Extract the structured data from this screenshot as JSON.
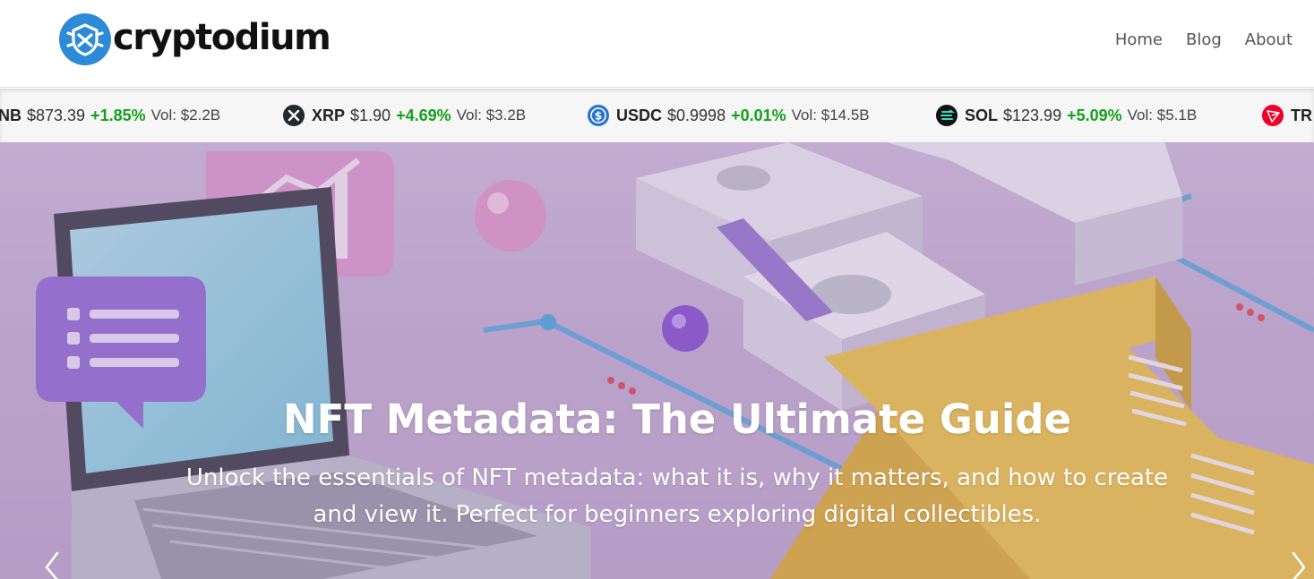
{
  "brand": {
    "name": "cryptodium",
    "logo_icon": "shield-coin-icon",
    "color": "#2d8ad6"
  },
  "nav": {
    "items": [
      {
        "label": "Home"
      },
      {
        "label": "Blog"
      },
      {
        "label": "About"
      }
    ]
  },
  "ticker": {
    "items": [
      {
        "symbol": "NB",
        "price": "$873.39",
        "change": "+1.85%",
        "volume": "Vol: $2.2B",
        "icon": "bnb-icon",
        "color": "#f3ba2f"
      },
      {
        "symbol": "XRP",
        "price": "$1.90",
        "change": "+4.69%",
        "volume": "Vol: $3.2B",
        "icon": "xrp-icon",
        "color": "#23292f"
      },
      {
        "symbol": "USDC",
        "price": "$0.9998",
        "change": "+0.01%",
        "volume": "Vol: $14.5B",
        "icon": "usdc-icon",
        "color": "#2775ca"
      },
      {
        "symbol": "SOL",
        "price": "$123.99",
        "change": "+5.09%",
        "volume": "Vol: $5.1B",
        "icon": "sol-icon",
        "color": "#111111"
      },
      {
        "symbol": "TR",
        "price": "",
        "change": "",
        "volume": "",
        "icon": "tron-icon",
        "color": "#ef0027"
      }
    ],
    "positive_color": "#14a01e"
  },
  "hero": {
    "title": "NFT Metadata: The Ultimate Guide",
    "description": "Unlock the essentials of NFT metadata: what it is, why it matters, and how to create and view it. Perfect for beginners exploring digital collectibles.",
    "prev_icon": "chevron-left-icon",
    "next_icon": "chevron-right-icon"
  }
}
